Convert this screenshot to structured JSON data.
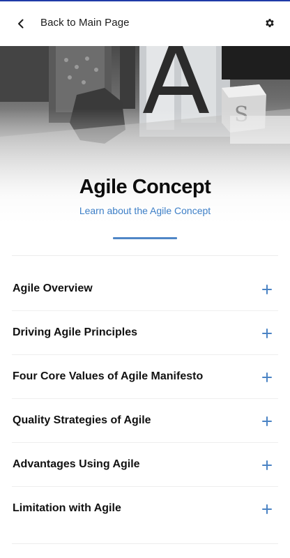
{
  "header": {
    "back_icon": "chevron-left-icon",
    "back_label": "Back to Main Page",
    "settings_icon": "gear-icon"
  },
  "hero": {
    "title": "Agile Concept",
    "subtitle": "Learn about the Agile Concept",
    "accent_color": "#4f86c6"
  },
  "sections": [
    {
      "label": "Agile Overview"
    },
    {
      "label": "Driving Agile Principles"
    },
    {
      "label": "Four Core Values of Agile Manifesto"
    },
    {
      "label": "Quality Strategies of Agile"
    },
    {
      "label": "Advantages Using Agile"
    },
    {
      "label": "Limitation with Agile"
    }
  ],
  "expand_icon": "plus-icon",
  "colors": {
    "top_bar": "#1f3aa8",
    "link_blue": "#3d7fc7",
    "plus_blue": "#4a83c4"
  }
}
